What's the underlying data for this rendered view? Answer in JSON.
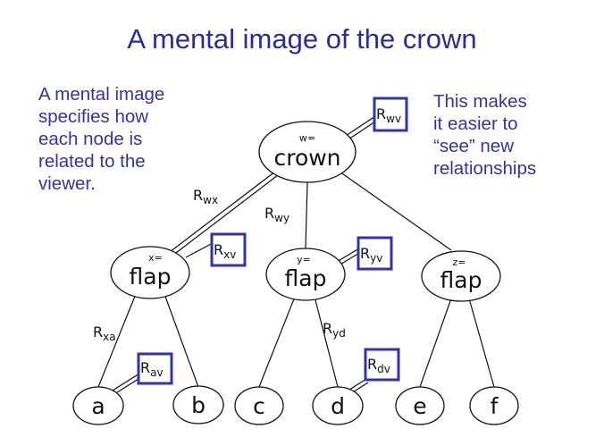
{
  "title": "A mental image of the crown",
  "notes": {
    "left": [
      "A mental image",
      "specifies how",
      "each node is",
      "related to the",
      "viewer."
    ],
    "right": [
      "This makes",
      "it easier to",
      "“see” new",
      "relationships"
    ]
  },
  "colors": {
    "accent": "#3333a6",
    "ink": "#111111"
  },
  "nodes": {
    "w": {
      "tag": "w=",
      "word": "crown"
    },
    "x": {
      "tag": "x=",
      "word": "flap"
    },
    "y": {
      "tag": "y=",
      "word": "flap"
    },
    "z": {
      "tag": "z=",
      "word": "flap"
    },
    "a": {
      "word": "a"
    },
    "b": {
      "word": "b"
    },
    "c": {
      "word": "c"
    },
    "d": {
      "word": "d"
    },
    "e": {
      "word": "e"
    },
    "f": {
      "word": "f"
    }
  },
  "edge_labels": {
    "wx": {
      "base": "R",
      "sub": "wx"
    },
    "wy": {
      "base": "R",
      "sub": "wy"
    },
    "xa": {
      "base": "R",
      "sub": "xa"
    },
    "yd": {
      "base": "R",
      "sub": "yd"
    }
  },
  "viewer_relations": {
    "wv": {
      "base": "R",
      "sub": "wv"
    },
    "xv": {
      "base": "R",
      "sub": "xv"
    },
    "yv": {
      "base": "R",
      "sub": "yv"
    },
    "av": {
      "base": "R",
      "sub": "av"
    },
    "dv": {
      "base": "R",
      "sub": "dv"
    }
  }
}
